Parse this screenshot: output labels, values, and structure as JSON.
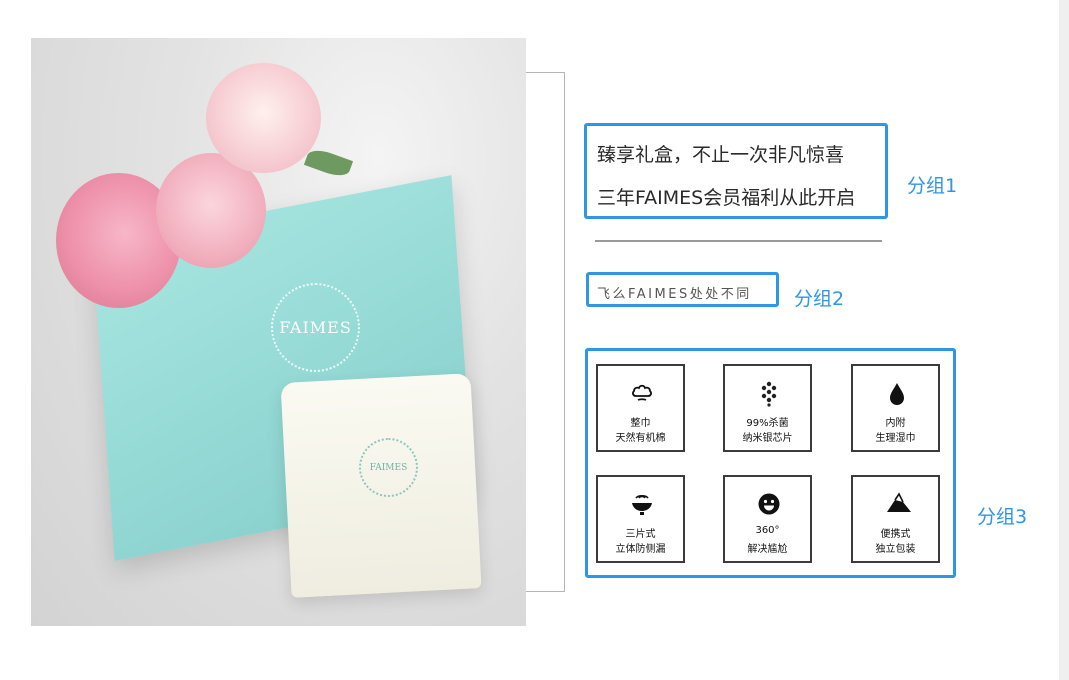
{
  "group1": {
    "line1": "臻享礼盒，不止一次非凡惊喜",
    "line2": "三年FAIMES会员福利从此开启",
    "label": "分组1"
  },
  "group2": {
    "text": "飞么FAIMES处处不同",
    "label": "分组2"
  },
  "group3": {
    "label": "分组3",
    "features": [
      {
        "icon": "cotton-flower-icon",
        "line1": "整巾",
        "line2": "天然有机棉"
      },
      {
        "icon": "honeycomb-icon",
        "line1": "99%杀菌",
        "line2": "纳米银芯片"
      },
      {
        "icon": "water-drop-icon",
        "line1": "内附",
        "line2": "生理湿巾"
      },
      {
        "icon": "layers-icon",
        "line1": "三片式",
        "line2": "立体防侧漏"
      },
      {
        "icon": "smiley-icon",
        "line1": "360°",
        "line2": "解决尴尬"
      },
      {
        "icon": "package-icon",
        "line1": "便携式",
        "line2": "独立包装"
      }
    ]
  },
  "product_image": {
    "bag_logo": "FAIMES",
    "pouch_logo": "FAIMES"
  },
  "colors": {
    "accent": "#2f95e6",
    "bag": "#9ee0dc",
    "card_border": "#3b3b3b"
  }
}
